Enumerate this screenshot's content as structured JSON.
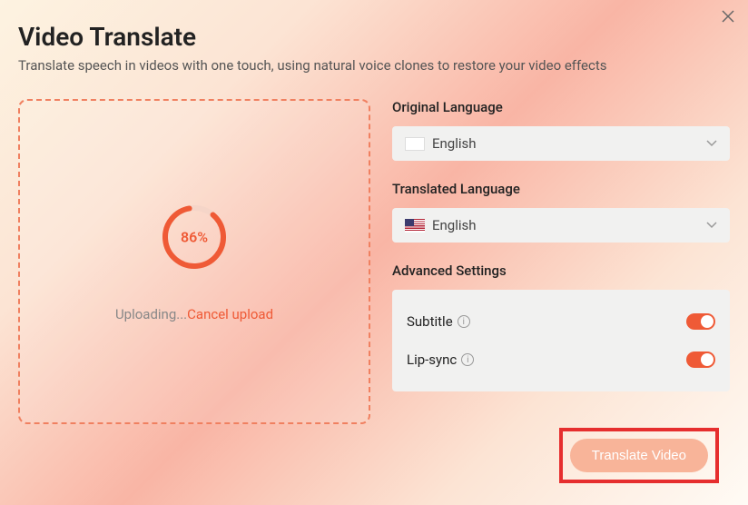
{
  "header": {
    "title": "Video Translate",
    "subtitle": "Translate speech in videos with one touch, using natural voice clones to restore your video effects"
  },
  "upload": {
    "progress_percent": "86%",
    "progress_value": 86,
    "status_text": "Uploading...",
    "cancel_label": "Cancel upload"
  },
  "settings": {
    "original_language_label": "Original Language",
    "original_language_value": "English",
    "translated_language_label": "Translated Language",
    "translated_language_value": "English",
    "advanced_label": "Advanced Settings",
    "subtitle_label": "Subtitle",
    "subtitle_on": true,
    "lipsync_label": "Lip-sync",
    "lipsync_on": true
  },
  "actions": {
    "translate_label": "Translate Video"
  }
}
